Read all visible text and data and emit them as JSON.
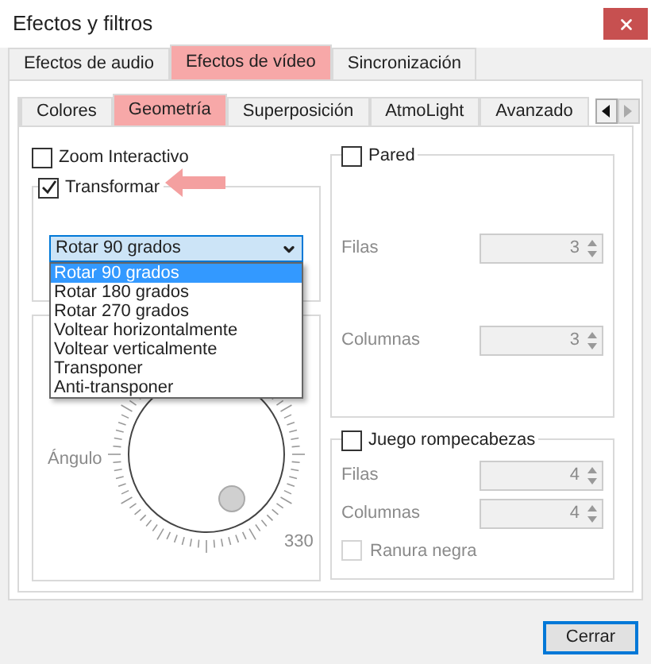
{
  "window": {
    "title": "Efectos y filtros"
  },
  "main_tabs": [
    {
      "label": "Efectos de audio",
      "selected": false
    },
    {
      "label": "Efectos de vídeo",
      "selected": true
    },
    {
      "label": "Sincronización",
      "selected": false
    }
  ],
  "sub_tabs": [
    {
      "label": "Colores",
      "selected": false
    },
    {
      "label": "Geometría",
      "selected": true
    },
    {
      "label": "Superposición",
      "selected": false
    },
    {
      "label": "AtmoLight",
      "selected": false
    },
    {
      "label": "Avanzado",
      "selected": false
    }
  ],
  "zoom_interactivo": {
    "label": "Zoom Interactivo",
    "checked": false
  },
  "transformar": {
    "label": "Transformar",
    "checked": true,
    "dropdown": {
      "value": "Rotar 90 grados",
      "expanded": true,
      "options": [
        {
          "label": "Rotar 90 grados",
          "selected": true
        },
        {
          "label": "Rotar 180 grados",
          "selected": false
        },
        {
          "label": "Rotar 270 grados",
          "selected": false
        },
        {
          "label": "Voltear horizontalmente",
          "selected": false
        },
        {
          "label": "Voltear verticalmente",
          "selected": false
        },
        {
          "label": "Transponer",
          "selected": false
        },
        {
          "label": "Anti-transponer",
          "selected": false
        }
      ]
    }
  },
  "rotate": {
    "label": "Ángulo",
    "reading": "330"
  },
  "pared": {
    "label": "Pared",
    "checked": false,
    "fields": [
      {
        "label": "Filas",
        "value": "3"
      },
      {
        "label": "Columnas",
        "value": "3"
      }
    ]
  },
  "puzzle": {
    "label": "Juego rompecabezas",
    "checked": false,
    "fields": [
      {
        "label": "Filas",
        "value": "4"
      },
      {
        "label": "Columnas",
        "value": "4"
      }
    ],
    "option": {
      "label": "Ranura negra",
      "checked": false,
      "disabled": true
    }
  },
  "buttons": [
    {
      "label": "Cerrar"
    }
  ]
}
